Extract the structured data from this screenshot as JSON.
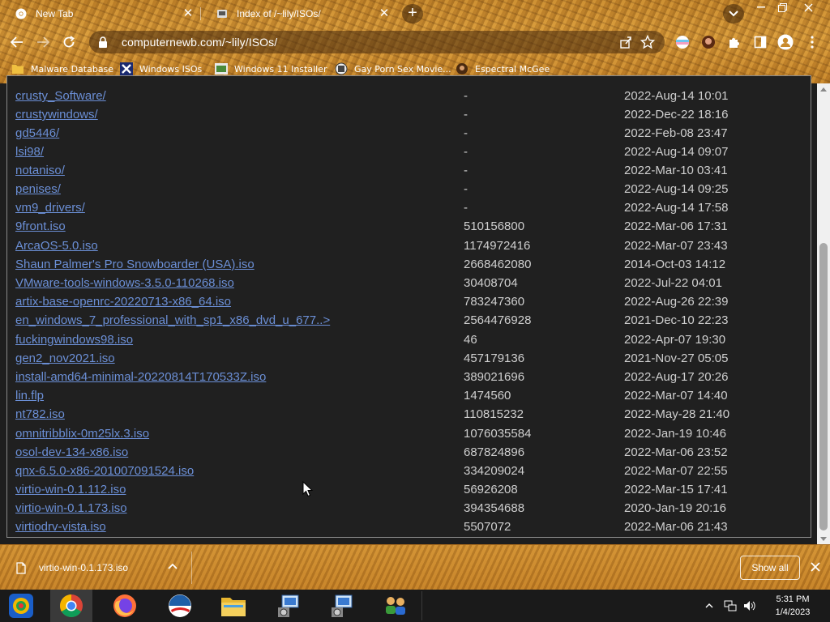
{
  "browser": {
    "tabs": [
      {
        "title": "New Tab",
        "favicon": "chrome-icon",
        "active": false
      },
      {
        "title": "Index of /~lily/ISOs/",
        "favicon": "folder-icon",
        "active": true
      }
    ],
    "new_tab": "+",
    "address": "computernewb.com/~lily/ISOs/",
    "bookmarks": [
      {
        "label": "Malware Database",
        "icon": "folder-icon"
      },
      {
        "label": "Windows ISOs",
        "icon": "x-logo-icon"
      },
      {
        "label": "Windows 11 Installer",
        "icon": "image-icon"
      },
      {
        "label": "Gay Porn Sex Movie...",
        "icon": "globe-icon"
      },
      {
        "label": "Espectral McGee",
        "icon": "avatar-icon"
      }
    ]
  },
  "listing": {
    "rows": [
      {
        "name": "crusty_Software/",
        "size": "-",
        "date": "2022-Aug-14 10:01"
      },
      {
        "name": "crustywindows/",
        "size": "-",
        "date": "2022-Dec-22 18:16"
      },
      {
        "name": "gd5446/",
        "size": "-",
        "date": "2022-Feb-08 23:47"
      },
      {
        "name": "lsi98/",
        "size": "-",
        "date": "2022-Aug-14 09:07"
      },
      {
        "name": "notaniso/",
        "size": "-",
        "date": "2022-Mar-10 03:41"
      },
      {
        "name": "penises/",
        "size": "-",
        "date": "2022-Aug-14 09:25"
      },
      {
        "name": "vm9_drivers/",
        "size": "-",
        "date": "2022-Aug-14 17:58"
      },
      {
        "name": "9front.iso",
        "size": "510156800",
        "date": "2022-Mar-06 17:31"
      },
      {
        "name": "ArcaOS-5.0.iso",
        "size": "1174972416",
        "date": "2022-Mar-07 23:43"
      },
      {
        "name": "Shaun Palmer's Pro Snowboarder (USA).iso",
        "size": "2668462080",
        "date": "2014-Oct-03 14:12"
      },
      {
        "name": "VMware-tools-windows-3.5.0-110268.iso",
        "size": "30408704",
        "date": "2022-Jul-22 04:01"
      },
      {
        "name": "artix-base-openrc-20220713-x86_64.iso",
        "size": "783247360",
        "date": "2022-Aug-26 22:39"
      },
      {
        "name": "en_windows_7_professional_with_sp1_x86_dvd_u_677..>",
        "size": "2564476928",
        "date": "2021-Dec-10 22:23"
      },
      {
        "name": "fuckingwindows98.iso",
        "size": "46",
        "date": "2022-Apr-07 19:30"
      },
      {
        "name": "gen2_nov2021.iso",
        "size": "457179136",
        "date": "2021-Nov-27 05:05"
      },
      {
        "name": "install-amd64-minimal-20220814T170533Z.iso",
        "size": "389021696",
        "date": "2022-Aug-17 20:26"
      },
      {
        "name": "lin.flp",
        "size": "1474560",
        "date": "2022-Mar-07 14:40"
      },
      {
        "name": "nt782.iso",
        "size": "110815232",
        "date": "2022-May-28 21:40"
      },
      {
        "name": "omnitribblix-0m25lx.3.iso",
        "size": "1076035584",
        "date": "2022-Jan-19 10:46"
      },
      {
        "name": "osol-dev-134-x86.iso",
        "size": "687824896",
        "date": "2022-Mar-06 23:52"
      },
      {
        "name": "qnx-6.5.0-x86-201007091524.iso",
        "size": "334209024",
        "date": "2022-Mar-07 22:55"
      },
      {
        "name": "virtio-win-0.1.112.iso",
        "size": "56926208",
        "date": "2022-Mar-15 17:41"
      },
      {
        "name": "virtio-win-0.1.173.iso",
        "size": "394354688",
        "date": "2020-Jan-19 20:16"
      },
      {
        "name": "virtiodrv-vista.iso",
        "size": "5507072",
        "date": "2022-Mar-06 21:43"
      }
    ]
  },
  "downloads": {
    "item": "virtio-win-0.1.173.iso",
    "show_all": "Show all"
  },
  "taskbar": {
    "apps": [
      "start-icon",
      "chrome-icon",
      "firefox-icon",
      "obama-logo-icon",
      "file-explorer-icon",
      "network-setup-icon",
      "network-setup-icon",
      "users-icon"
    ],
    "clock_time": "5:31 PM",
    "clock_date": "1/4/2023"
  },
  "colors": {
    "link": "#6b8fd6",
    "text": "#cfcfcf",
    "background": "#202020",
    "chrome_wood": "#d09030"
  }
}
